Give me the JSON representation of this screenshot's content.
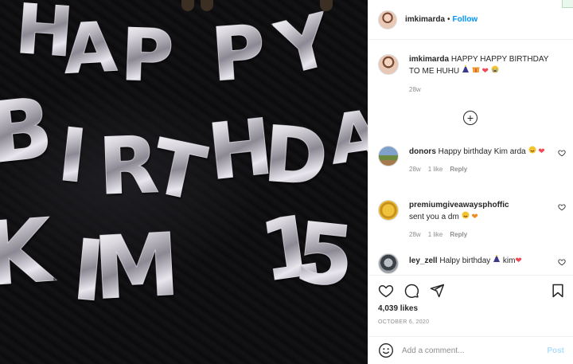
{
  "post": {
    "photo_description_icon": "balloon-photo",
    "balloon_letters": {
      "row1": [
        "H",
        "A",
        "P",
        "P",
        "Y"
      ],
      "row2": [
        "B",
        "I",
        "R",
        "T",
        "H",
        "D",
        "A"
      ],
      "row3": [
        "K",
        "I",
        "M",
        "1",
        "5"
      ]
    }
  },
  "header": {
    "username": "imkimarda",
    "separator": "•",
    "follow_label": "Follow"
  },
  "caption": {
    "username": "imkimarda",
    "text": "HAPPY HAPPY BIRTHDAY TO ME HUHU",
    "time": "28w"
  },
  "load_more_label": "+",
  "comments": [
    {
      "username": "donors",
      "text": "Happy birthday Kim arda",
      "time": "28w",
      "likes": "1 like",
      "reply": "Reply"
    },
    {
      "username": "premiumgiveawaysphoffic",
      "text": "sent you a dm",
      "time": "28w",
      "likes": "1 like",
      "reply": "Reply"
    },
    {
      "username": "ley_zell",
      "text": "Halpy birthday",
      "text_after": "kim"
    }
  ],
  "likes": "4,039 likes",
  "date": "OCTOBER 6, 2020",
  "add_comment": {
    "placeholder": "Add a comment...",
    "post_label": "Post"
  },
  "colors": {
    "link_blue": "#0095f6",
    "post_disabled": "#b2dffc",
    "heart_red": "#ed4956",
    "muted": "#8e8e8e"
  }
}
